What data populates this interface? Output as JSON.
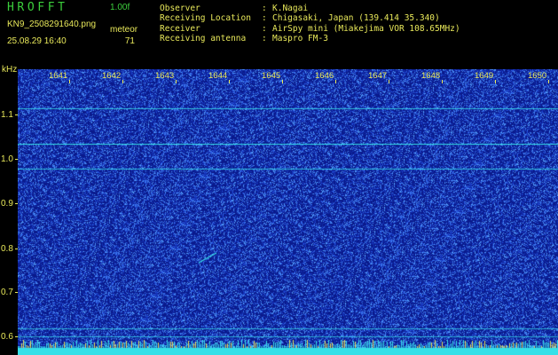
{
  "header": {
    "app_title": "HROFFT",
    "version": "1.00f",
    "filename": "KN9_2508291640.png",
    "meteor_label": "meteor",
    "datetime": "25.08.29 16:40",
    "meteor_count": "71",
    "info": [
      {
        "label": "Observer",
        "value": "K.Nagai"
      },
      {
        "label": "Receiving Location",
        "value": "Chigasaki, Japan (139.414 35.340)"
      },
      {
        "label": "Receiver",
        "value": "AirSpy mini (Miakejima VOR 108.65MHz)"
      },
      {
        "label": "Receiving antenna",
        "value": "Maspro FM-3"
      }
    ]
  },
  "axis": {
    "unit": "kHz",
    "y_ticks": [
      "1.1",
      "1.0",
      "0.9",
      "0.8",
      "0.7",
      "0.6"
    ],
    "x_ticks": [
      "1641",
      "1642",
      "1643",
      "1644",
      "1645",
      "1646",
      "1647",
      "1648",
      "1649",
      "1650"
    ]
  },
  "colors": {
    "background": "#0a1a8c",
    "noise": "#3f7cff",
    "carrier": "#36e0e8",
    "label": "#e8e85a",
    "title": "#3ccf3c"
  }
}
